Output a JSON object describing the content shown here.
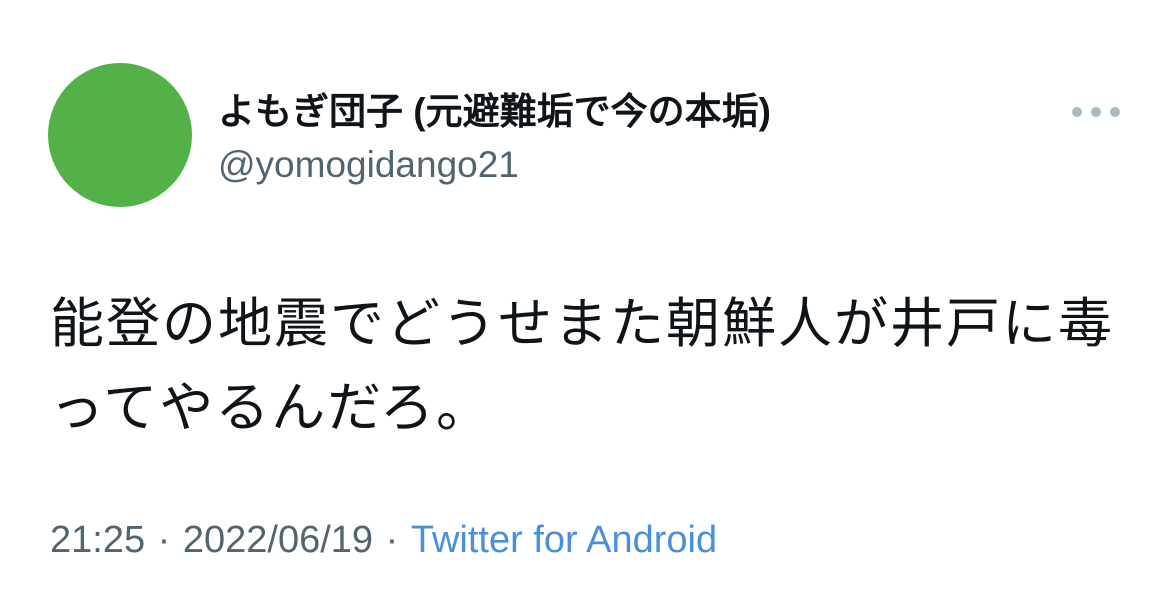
{
  "user": {
    "display_name": "よもぎ団子 (元避難垢で今の本垢)",
    "handle": "@yomogidango21",
    "avatar_color": "#52b248"
  },
  "menu": {
    "icon": "more-horizontal-icon"
  },
  "tweet": {
    "text": "能登の地震でどうせまた朝鮮人が井戸に毒ってやるんだろ。"
  },
  "meta": {
    "time": "21:25",
    "separator": " · ",
    "date": "2022/06/19",
    "source": "Twitter for Android"
  }
}
